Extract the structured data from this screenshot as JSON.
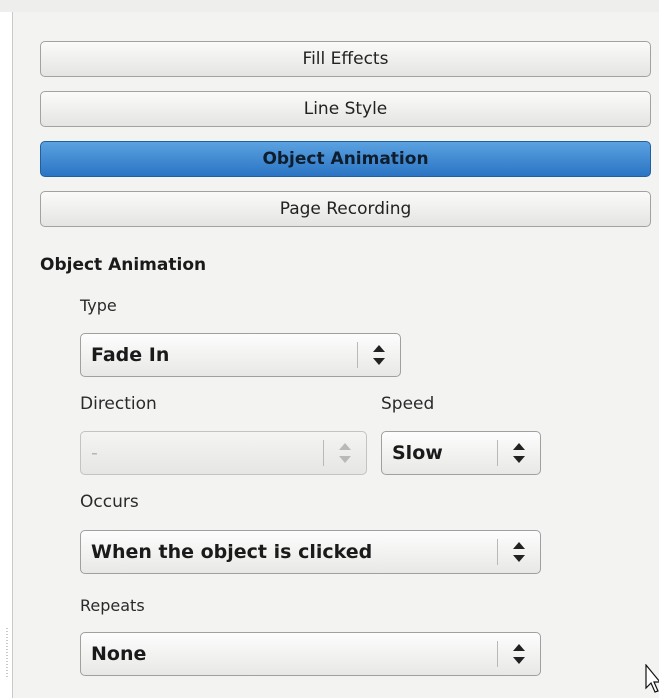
{
  "tabs": [
    {
      "label": "Fill Effects",
      "active": false
    },
    {
      "label": "Line Style",
      "active": false
    },
    {
      "label": "Object Animation",
      "active": true
    },
    {
      "label": "Page Recording",
      "active": false
    }
  ],
  "section": {
    "title": "Object Animation"
  },
  "type": {
    "label": "Type",
    "value": "Fade In"
  },
  "direction": {
    "label": "Direction",
    "value": "-"
  },
  "speed": {
    "label": "Speed",
    "value": "Slow"
  },
  "occurs": {
    "label": "Occurs",
    "value": "When the object is clicked"
  },
  "repeats": {
    "label": "Repeats",
    "value": "None"
  },
  "icons": {
    "combo_arrow": "up-down-arrows-icon",
    "pointer": "mouse-pointer-icon"
  },
  "colors": {
    "active_tab": "#2f7fd0",
    "panel_bg": "#f3f3f2"
  }
}
